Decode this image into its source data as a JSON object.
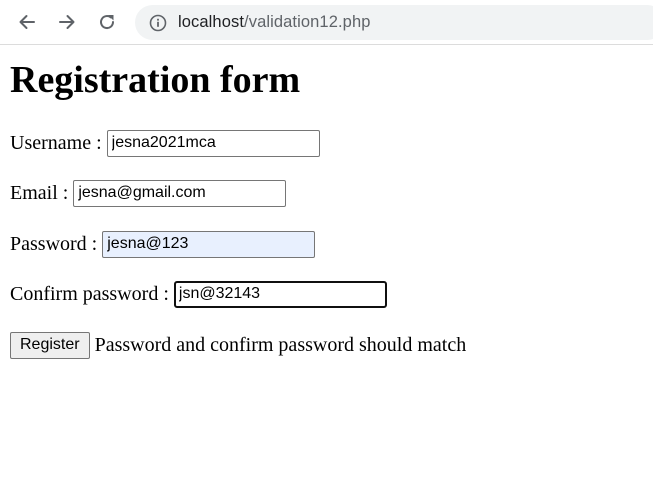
{
  "browser": {
    "url_host": "localhost",
    "url_path": "/validation12.php"
  },
  "page": {
    "title": "Registration form",
    "username": {
      "label": "Username : ",
      "value": "jesna2021mca"
    },
    "email": {
      "label": "Email : ",
      "value": "jesna@gmail.com"
    },
    "password": {
      "label": "Password : ",
      "value": "jesna@123"
    },
    "confirm_password": {
      "label": "Confirm password : ",
      "value": "jsn@32143"
    },
    "register_label": "Register",
    "message": "Password and confirm password should match"
  }
}
